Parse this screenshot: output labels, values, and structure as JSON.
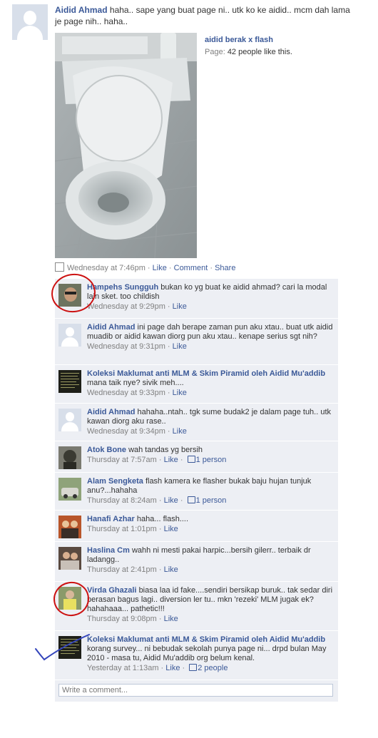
{
  "post": {
    "author": "Aidid Ahmad",
    "message": "haha.. sape yang buat page ni.. utk ko ke aidid.. mcm dah lama je page nih.. haha..",
    "attachment": {
      "title": "aidid berak x flash",
      "type_label": "Page:",
      "likes_text": "42 people like this."
    },
    "timestamp": "Wednesday at 7:46pm",
    "actions": [
      "Like",
      "Comment",
      "Share"
    ]
  },
  "comments": [
    {
      "author": "Hampehs Sungguh",
      "text": "bukan ko yg buat ke aidid ahmad? cari la modal lain sket. too childish",
      "time": "Wednesday at 9:29pm",
      "like": "Like",
      "likes": ""
    },
    {
      "author": "Aidid Ahmad",
      "text": "ini page dah berape zaman pun aku xtau.. buat utk aidid muadib or aidid kawan diorg pun aku xtau.. kenape serius sgt nih?",
      "time": "Wednesday at 9:31pm",
      "like": "Like",
      "likes": ""
    },
    {
      "author": "Koleksi Maklumat anti MLM & Skim Piramid oleh Aidid Mu'addib",
      "text": "mana taik nye? sivik meh....",
      "time": "Wednesday at 9:33pm",
      "like": "Like",
      "likes": ""
    },
    {
      "author": "Aidid Ahmad",
      "text": "hahaha..ntah.. tgk sume budak2 je dalam page tuh.. utk kawan diorg aku rase..",
      "time": "Wednesday at 9:34pm",
      "like": "Like",
      "likes": ""
    },
    {
      "author": "Atok Bone",
      "text": "wah tandas yg bersih",
      "time": "Thursday at 7:57am",
      "like": "Like",
      "likes": "1 person"
    },
    {
      "author": "Alam Sengketa",
      "text": "flash kamera ke flasher bukak baju hujan tunjuk anu?...hahaha",
      "time": "Thursday at 8:24am",
      "like": "Like",
      "likes": "1 person"
    },
    {
      "author": "Hanafi Azhar",
      "text": "haha... flash....",
      "time": "Thursday at 1:01pm",
      "like": "Like",
      "likes": ""
    },
    {
      "author": "Haslina Cm",
      "text": "wahh ni mesti pakai harpic...bersih gilerr.. terbaik dr ladangg..",
      "time": "Thursday at 2:41pm",
      "like": "Like",
      "likes": ""
    },
    {
      "author": "Virda Ghazali",
      "text": "biasa laa id fake....sendiri bersikap buruk.. tak sedar diri perasan bagus lagi.. diversion ler tu.. mkn 'rezeki' MLM jugak ek? hahahaaa... pathetic!!!",
      "time": "Thursday at 9:08pm",
      "like": "Like",
      "likes": ""
    },
    {
      "author": "Koleksi Maklumat anti MLM & Skim Piramid oleh Aidid Mu'addib",
      "text": "korang survey... ni bebudak sekolah punya page ni... drpd bulan May 2010 - masa tu, Aidid Mu'addib org belum kenal.",
      "time": "Yesterday at 1:13am",
      "like": "Like",
      "likes": "2 people"
    }
  ],
  "composer": {
    "placeholder": "Write a comment..."
  }
}
